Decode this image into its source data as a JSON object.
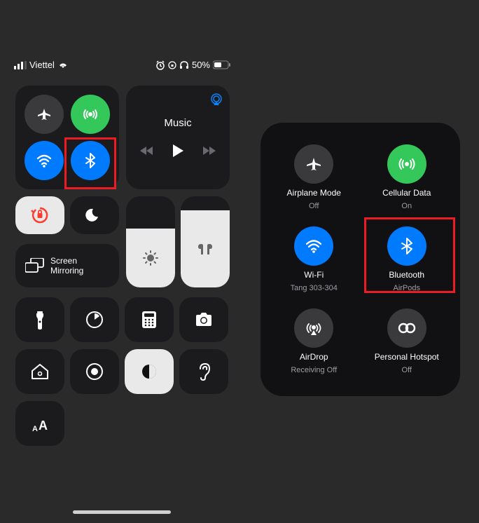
{
  "status": {
    "carrier": "Viettel",
    "battery": "50%"
  },
  "music": {
    "title": "Music"
  },
  "screen_mirroring": {
    "line1": "Screen",
    "line2": "Mirroring"
  },
  "text_size": {
    "label": "AA"
  },
  "sliders": {
    "brightness_pct": 65,
    "volume_pct": 85
  },
  "expanded": {
    "airplane": {
      "label": "Airplane Mode",
      "sub": "Off"
    },
    "cellular": {
      "label": "Cellular Data",
      "sub": "On"
    },
    "wifi": {
      "label": "Wi-Fi",
      "sub": "Tang 303-304"
    },
    "bluetooth": {
      "label": "Bluetooth",
      "sub": "AirPods"
    },
    "airdrop": {
      "label": "AirDrop",
      "sub": "Receiving Off"
    },
    "hotspot": {
      "label": "Personal Hotspot",
      "sub": "Off"
    }
  }
}
